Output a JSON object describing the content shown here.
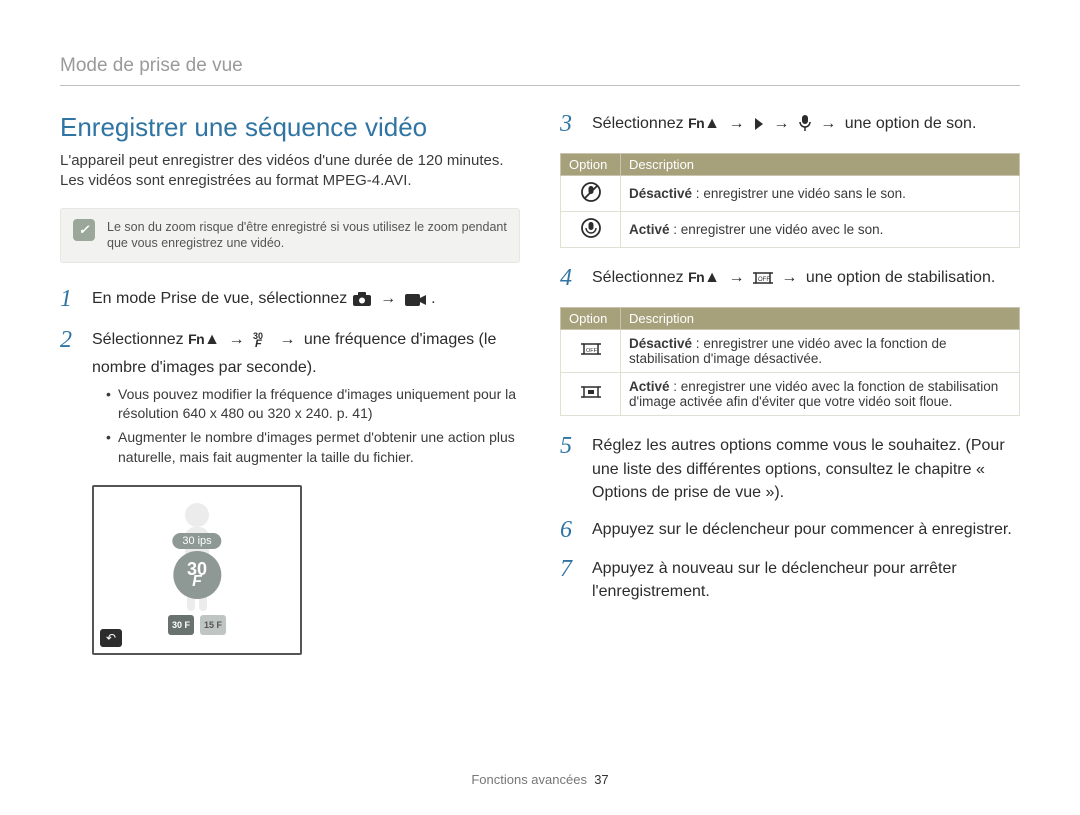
{
  "breadcrumb": "Mode de prise de vue",
  "title": "Enregistrer une séquence vidéo",
  "intro": "L'appareil peut enregistrer des vidéos d'une durée de 120 minutes. Les vidéos sont enregistrées au format MPEG-4.AVI.",
  "note": "Le son du zoom risque d'être enregistré si vous utilisez le zoom pendant que vous enregistrez une vidéo.",
  "steps": {
    "s1": {
      "num": "1",
      "text_a": "En mode Prise de vue, sélectionnez ",
      "text_b": "."
    },
    "s2": {
      "num": "2",
      "text_a": "Sélectionnez ",
      "text_b": " une fréquence d'images (le nombre d'images par seconde).",
      "bullet1": "Vous pouvez modifier la fréquence d'images uniquement pour la résolution 640 x 480 ou 320 x 240. p. 41)",
      "bullet2": "Augmenter le nombre d'images permet d'obtenir une action plus naturelle, mais fait augmenter la taille du fichier."
    },
    "s3": {
      "num": "3",
      "text_a": "Sélectionnez ",
      "text_b": " une option de son."
    },
    "s4": {
      "num": "4",
      "text_a": "Sélectionnez ",
      "text_b": " une option de stabilisation."
    },
    "s5": {
      "num": "5",
      "text": "Réglez les autres options comme vous le souhaitez. (Pour une liste des différentes options, consultez le chapitre « Options de prise de vue »)."
    },
    "s6": {
      "num": "6",
      "text": "Appuyez sur le déclencheur pour commencer à enregistrer."
    },
    "s7": {
      "num": "7",
      "text": "Appuyez à nouveau sur le déclencheur pour arrêter l'enregistrement."
    }
  },
  "icons": {
    "fn": "Fn",
    "arrow": "→"
  },
  "screenshot": {
    "label": "30 ips",
    "badge_top": "30",
    "badge_bottom": "F",
    "thumb1": "30 F",
    "thumb2": "15 F",
    "back": "↶"
  },
  "table_sound": {
    "h1": "Option",
    "h2": "Description",
    "r1_label": "Désactivé",
    "r1_colon": " : ",
    "r1_text": "enregistrer une vidéo sans le son.",
    "r2_label": "Activé",
    "r2_colon": " : ",
    "r2_text": "enregistrer une vidéo avec le son."
  },
  "table_stab": {
    "h1": "Option",
    "h2": "Description",
    "r1_label": "Désactivé",
    "r1_colon": " : ",
    "r1_text": "enregistrer une vidéo avec la fonction de stabilisation d'image désactivée.",
    "r2_label": "Activé",
    "r2_colon": " : ",
    "r2_text": "enregistrer une vidéo avec la fonction de stabilisation d'image activée afin d'éviter que votre vidéo soit floue."
  },
  "footer": {
    "section": "Fonctions avancées",
    "page": "37"
  }
}
